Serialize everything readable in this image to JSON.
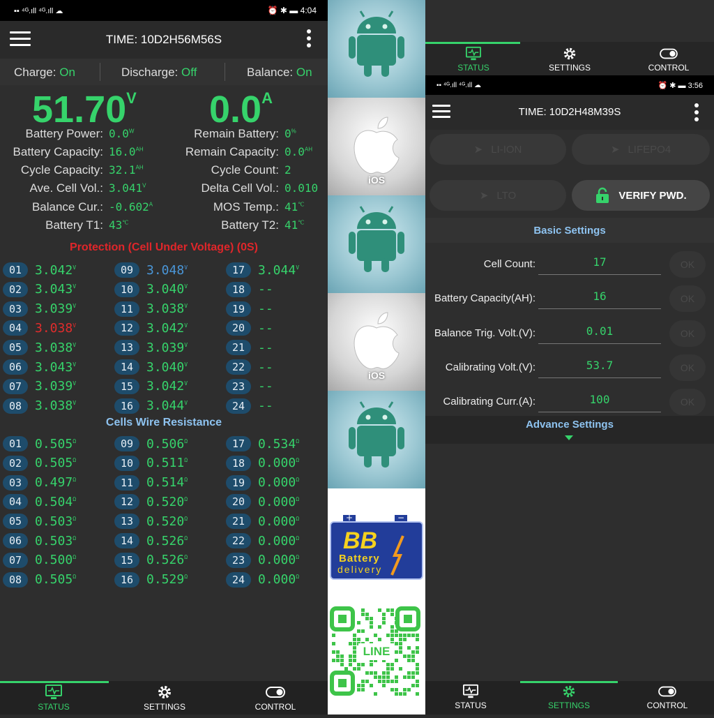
{
  "left": {
    "status_time": "4:04",
    "title": "TIME: 10D2H56M56S",
    "charge_label": "Charge:",
    "charge_val": "On",
    "discharge_label": "Discharge:",
    "discharge_val": "Off",
    "balance_label": "Balance:",
    "balance_val": "On",
    "voltage": "51.70",
    "voltage_unit": "V",
    "current": "0.0",
    "current_unit": "A",
    "stats_left": [
      {
        "label": "Battery Power:",
        "value": "0.0",
        "unit": "W"
      },
      {
        "label": "Battery Capacity:",
        "value": "16.0",
        "unit": "AH"
      },
      {
        "label": "Cycle Capacity:",
        "value": "32.1",
        "unit": "AH"
      },
      {
        "label": "Ave. Cell Vol.:",
        "value": "3.041",
        "unit": "V"
      },
      {
        "label": "Balance Cur.:",
        "value": "-0.602",
        "unit": "A"
      },
      {
        "label": "Battery T1:",
        "value": "43",
        "unit": "℃"
      }
    ],
    "stats_right": [
      {
        "label": "Remain Battery:",
        "value": "0",
        "unit": "%"
      },
      {
        "label": "Remain Capacity:",
        "value": "0.0",
        "unit": "AH"
      },
      {
        "label": "Cycle Count:",
        "value": "2",
        "unit": ""
      },
      {
        "label": "Delta Cell Vol.:",
        "value": "0.010",
        "unit": ""
      },
      {
        "label": "MOS Temp.:",
        "value": "41",
        "unit": "℃"
      },
      {
        "label": "Battery T2:",
        "value": "41",
        "unit": "℃"
      }
    ],
    "protection_title": "Protection (Cell Under Voltage) (0S)",
    "cell_voltages": [
      {
        "n": "01",
        "v": "3.042",
        "u": "V"
      },
      {
        "n": "02",
        "v": "3.043",
        "u": "V"
      },
      {
        "n": "03",
        "v": "3.039",
        "u": "V"
      },
      {
        "n": "04",
        "v": "3.038",
        "u": "V"
      },
      {
        "n": "05",
        "v": "3.038",
        "u": "V"
      },
      {
        "n": "06",
        "v": "3.043",
        "u": "V"
      },
      {
        "n": "07",
        "v": "3.039",
        "u": "V"
      },
      {
        "n": "08",
        "v": "3.038",
        "u": "V"
      },
      {
        "n": "09",
        "v": "3.048",
        "u": "V"
      },
      {
        "n": "10",
        "v": "3.040",
        "u": "V"
      },
      {
        "n": "11",
        "v": "3.038",
        "u": "V"
      },
      {
        "n": "12",
        "v": "3.042",
        "u": "V"
      },
      {
        "n": "13",
        "v": "3.039",
        "u": "V"
      },
      {
        "n": "14",
        "v": "3.040",
        "u": "V"
      },
      {
        "n": "15",
        "v": "3.042",
        "u": "V"
      },
      {
        "n": "16",
        "v": "3.044",
        "u": "V"
      },
      {
        "n": "17",
        "v": "3.044",
        "u": "V"
      },
      {
        "n": "18",
        "v": "--",
        "u": ""
      },
      {
        "n": "19",
        "v": "--",
        "u": ""
      },
      {
        "n": "20",
        "v": "--",
        "u": ""
      },
      {
        "n": "21",
        "v": "--",
        "u": ""
      },
      {
        "n": "22",
        "v": "--",
        "u": ""
      },
      {
        "n": "23",
        "v": "--",
        "u": ""
      },
      {
        "n": "24",
        "v": "--",
        "u": ""
      }
    ],
    "resistance_title": "Cells Wire Resistance",
    "cell_resistances": [
      {
        "n": "01",
        "v": "0.505",
        "u": "Ω"
      },
      {
        "n": "02",
        "v": "0.505",
        "u": "Ω"
      },
      {
        "n": "03",
        "v": "0.497",
        "u": "Ω"
      },
      {
        "n": "04",
        "v": "0.504",
        "u": "Ω"
      },
      {
        "n": "05",
        "v": "0.503",
        "u": "Ω"
      },
      {
        "n": "06",
        "v": "0.503",
        "u": "Ω"
      },
      {
        "n": "07",
        "v": "0.500",
        "u": "Ω"
      },
      {
        "n": "08",
        "v": "0.505",
        "u": "Ω"
      },
      {
        "n": "09",
        "v": "0.506",
        "u": "Ω"
      },
      {
        "n": "10",
        "v": "0.511",
        "u": "Ω"
      },
      {
        "n": "11",
        "v": "0.514",
        "u": "Ω"
      },
      {
        "n": "12",
        "v": "0.520",
        "u": "Ω"
      },
      {
        "n": "13",
        "v": "0.520",
        "u": "Ω"
      },
      {
        "n": "14",
        "v": "0.526",
        "u": "Ω"
      },
      {
        "n": "15",
        "v": "0.526",
        "u": "Ω"
      },
      {
        "n": "16",
        "v": "0.529",
        "u": "Ω"
      },
      {
        "n": "17",
        "v": "0.534",
        "u": "Ω"
      },
      {
        "n": "18",
        "v": "0.000",
        "u": "Ω"
      },
      {
        "n": "19",
        "v": "0.000",
        "u": "Ω"
      },
      {
        "n": "20",
        "v": "0.000",
        "u": "Ω"
      },
      {
        "n": "21",
        "v": "0.000",
        "u": "Ω"
      },
      {
        "n": "22",
        "v": "0.000",
        "u": "Ω"
      },
      {
        "n": "23",
        "v": "0.000",
        "u": "Ω"
      },
      {
        "n": "24",
        "v": "0.000",
        "u": "Ω"
      }
    ],
    "highlight_red_cell": "04",
    "highlight_blue_cell": "09",
    "nav": {
      "status": "STATUS",
      "settings": "SETTINGS",
      "control": "CONTROL"
    }
  },
  "middle": {
    "ios_label": "iOS",
    "bb_logo": "BB",
    "bb_line1": "Battery",
    "bb_line2": "delivery",
    "line_label": "LINE"
  },
  "right": {
    "nav": {
      "status": "STATUS",
      "settings": "SETTINGS",
      "control": "CONTROL"
    },
    "status_time": "3:56",
    "title": "TIME: 10D2H48M39S",
    "type_buttons": [
      "LI-ION",
      "LIFEPO4",
      "LTO"
    ],
    "verify_label": "VERIFY PWD.",
    "basic_settings": "Basic Settings",
    "settings": [
      {
        "label": "Cell Count:",
        "value": "17"
      },
      {
        "label": "Battery Capacity(AH):",
        "value": "16"
      },
      {
        "label": "Balance Trig. Volt.(V):",
        "value": "0.01"
      },
      {
        "label": "Calibrating Volt.(V):",
        "value": "53.7"
      },
      {
        "label": "Calibrating Curr.(A):",
        "value": "100"
      }
    ],
    "ok_label": "OK",
    "advance_settings": "Advance Settings"
  },
  "colors": {
    "accent": "#36d36b",
    "alert": "#e0262a",
    "badge": "#1e4c6b"
  }
}
